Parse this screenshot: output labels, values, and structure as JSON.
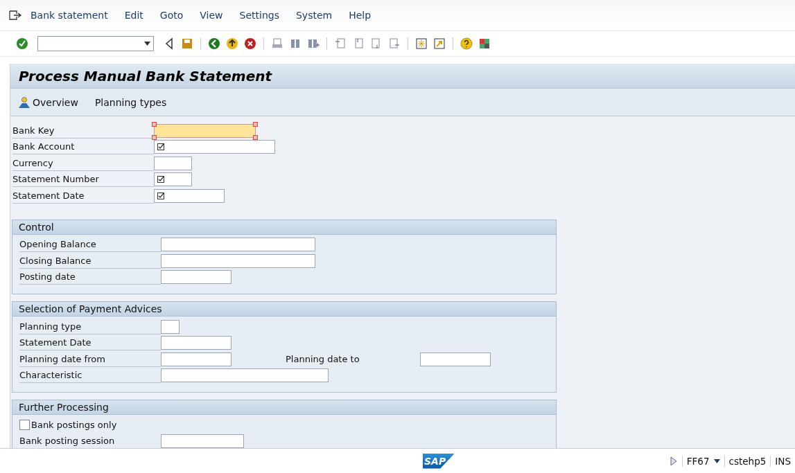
{
  "menu": [
    {
      "label": "Bank statement"
    },
    {
      "label": "Edit"
    },
    {
      "label": "Goto"
    },
    {
      "label": "View"
    },
    {
      "label": "Settings"
    },
    {
      "label": "System"
    },
    {
      "label": "Help"
    }
  ],
  "title": "Process Manual Bank Statement",
  "app_toolbar": [
    {
      "label": "Overview",
      "icon": true
    },
    {
      "label": "Planning types",
      "icon": false
    }
  ],
  "header_fields": [
    {
      "label": "Bank Key",
      "required": false,
      "focused": true
    },
    {
      "label": "Bank Account",
      "required": true,
      "focused": false
    },
    {
      "label": "Currency",
      "required": false,
      "focused": false
    },
    {
      "label": "Statement Number",
      "required": true,
      "focused": false
    },
    {
      "label": "Statement Date",
      "required": true,
      "focused": false
    }
  ],
  "groups": [
    {
      "title": "Control",
      "rows": [
        {
          "kind": "field",
          "label": "Opening Balance"
        },
        {
          "kind": "field",
          "label": "Closing Balance"
        },
        {
          "kind": "field",
          "label": "Posting date"
        }
      ]
    },
    {
      "title": "Selection of Payment Advices",
      "rows": [
        {
          "kind": "field",
          "label": "Planning type"
        },
        {
          "kind": "field",
          "label": "Statement Date"
        },
        {
          "kind": "range",
          "label": "Planning date from",
          "to_label": "Planning date to"
        },
        {
          "kind": "field",
          "label": "Characteristic"
        }
      ]
    },
    {
      "title": "Further Processing",
      "rows": [
        {
          "kind": "checkbox",
          "label": "Bank postings only",
          "checked": false
        },
        {
          "kind": "field",
          "label": "Bank posting session"
        }
      ]
    }
  ],
  "status_bar": {
    "logo": "SAP",
    "transaction": "FF67",
    "server": "cstehp5",
    "mode": "INS"
  }
}
